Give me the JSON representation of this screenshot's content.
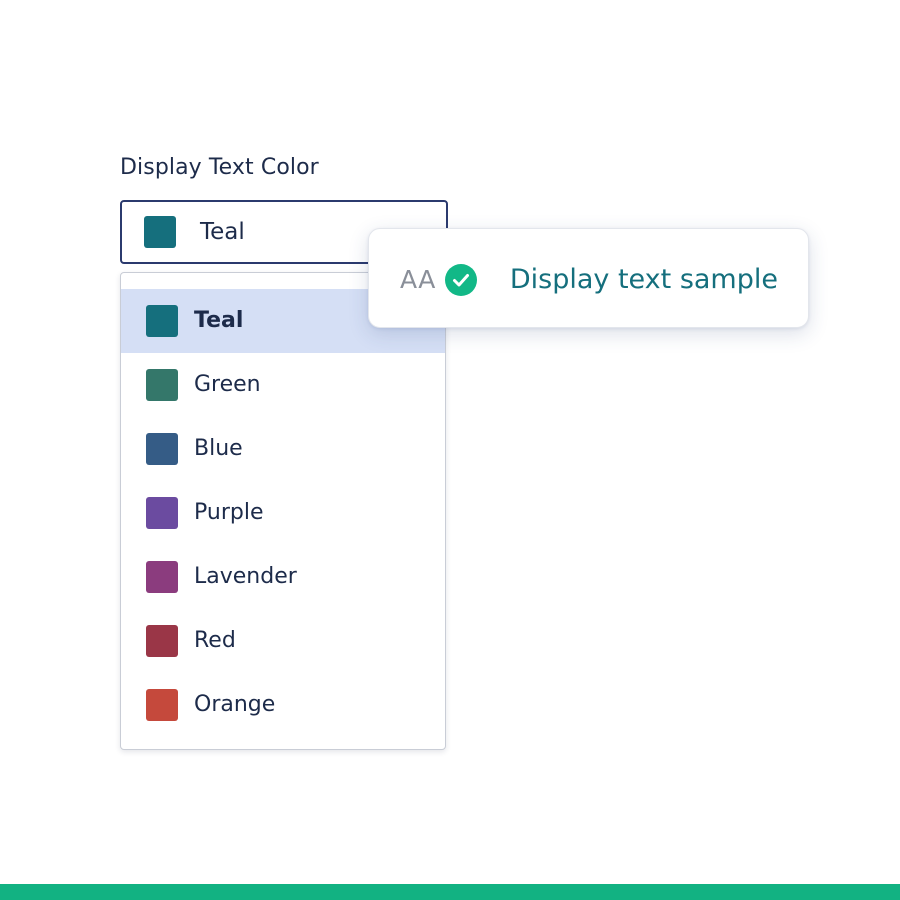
{
  "field": {
    "label": "Display Text Color",
    "selected": {
      "label": "Teal",
      "color": "#156f7d"
    },
    "chevron_icon": "chevron-down-icon"
  },
  "menu": {
    "options": [
      {
        "label": "Teal",
        "color": "#156f7d",
        "selected": true
      },
      {
        "label": "Green",
        "color": "#34776a",
        "selected": false
      },
      {
        "label": "Blue",
        "color": "#355c86",
        "selected": false
      },
      {
        "label": "Purple",
        "color": "#6b4ba0",
        "selected": false
      },
      {
        "label": "Lavender",
        "color": "#8b3c7e",
        "selected": false
      },
      {
        "label": "Red",
        "color": "#9a3647",
        "selected": false
      },
      {
        "label": "Orange",
        "color": "#c5493c",
        "selected": false
      }
    ]
  },
  "contrast_tooltip": {
    "rating": "AA",
    "status_icon": "check-circle-icon",
    "status_color": "#12b887",
    "sample_text": "Display text sample",
    "sample_color": "#156f7d"
  },
  "colors": {
    "accent_bar": "#12b282",
    "highlight": "#d5dff5",
    "border": "#2b3a6e"
  }
}
